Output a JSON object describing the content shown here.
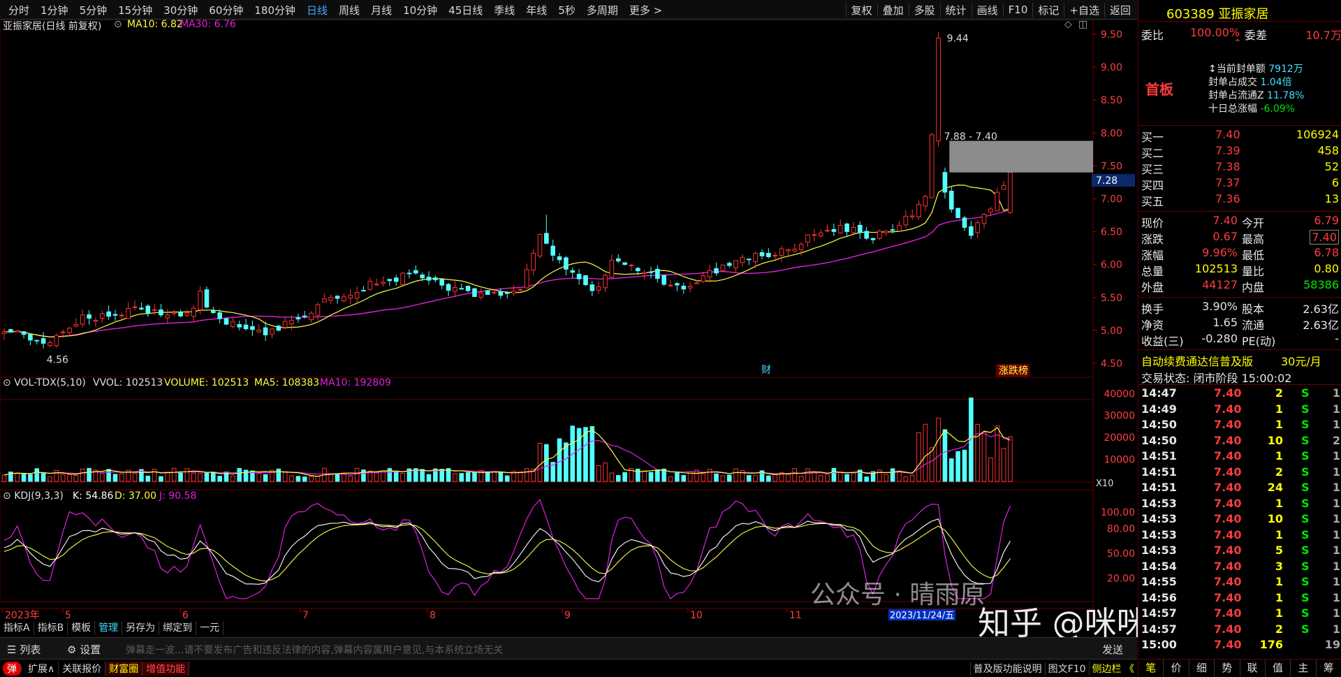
{
  "toolbar": {
    "tabs": [
      "分时",
      "1分钟",
      "5分钟",
      "15分钟",
      "30分钟",
      "60分钟",
      "180分钟",
      "日线",
      "周线",
      "月线",
      "10分钟",
      "45日线",
      "季线",
      "年线",
      "5秒",
      "多周期",
      "更多 >"
    ],
    "active": "日线",
    "tools": [
      "复权",
      "叠加",
      "多股",
      "统计",
      "画线",
      "F10",
      "标记",
      "+自选",
      "返回"
    ]
  },
  "chart": {
    "title": "亚振家居(日线 前复权)",
    "ma10": "MA10: 6.82",
    "ma30": "MA30: 6.76",
    "price_ticks": [
      "9.50",
      "9.00",
      "8.50",
      "8.00",
      "7.50",
      "7.00",
      "6.50",
      "6.00",
      "5.50",
      "5.00",
      "4.50"
    ],
    "current_price_tag": "7.28",
    "high_label": "9.44",
    "low_label": "4.56",
    "range_label": "7.88 - 7.40",
    "cai_marker": "财",
    "zhangting_marker": "涨跌榜",
    "vol_title": "VOL-TDX(5,10)",
    "vvol": "VVOL: 102513",
    "volume": "VOLUME: 102513",
    "vma5": "MA5: 108383",
    "vma10": "MA10: 192809",
    "vol_ticks": [
      "40000",
      "30000",
      "20000",
      "10000"
    ],
    "vol_unit": "X10",
    "kdj_title": "KDJ(9,3,3)",
    "kdj_k": "K: 54.86",
    "kdj_d": "D: 37.00",
    "kdj_j": "J: 90.58",
    "kdj_ticks": [
      "100.00",
      "80.00",
      "50.00",
      "20.00"
    ],
    "months": [
      "2023年",
      "5",
      "6",
      "7",
      "8",
      "9",
      "10",
      "11"
    ],
    "date_tag": "2023/11/24/五"
  },
  "colors": {
    "up": "#ff3232",
    "down": "#54ffff",
    "ma10": "#ffff44",
    "ma30": "#e020e0",
    "k": "#ffffff",
    "d": "#ffff44",
    "j": "#e020e0"
  },
  "bottom": {
    "row1": [
      "指标A",
      "指标B",
      "模板",
      "管理",
      "另存为",
      "绑定到",
      "一元"
    ],
    "row1_active": "管理",
    "list": "列表",
    "settings": "设置",
    "barrage": "弹幕走一波...请不要发布广告和违反法律的内容,弹幕内容属用户意见,与本系统立场无关",
    "send": "发送",
    "row3": [
      "弹",
      "扩展∧",
      "关联报价",
      "财富圈",
      "增值功能"
    ],
    "status_right": [
      "普及版功能说明",
      "图文F10",
      "侧边栏 《"
    ]
  },
  "panel": {
    "code": "603389",
    "name": "亚振家居",
    "weibi_label": "委比",
    "weibi": "100.00%",
    "weicha_label": "委差",
    "weicha": "10.7万",
    "first_board": "首板",
    "seal_info": [
      {
        "k": "当前封单额",
        "v": "7912万"
      },
      {
        "k": "封单占成交",
        "v": "1.04倍"
      },
      {
        "k": "封单占流通Z",
        "v": "11.78%"
      },
      {
        "k": "十日总涨幅",
        "v": "-6.09%"
      }
    ],
    "bids": [
      {
        "n": "买一",
        "p": "7.40",
        "v": "106924"
      },
      {
        "n": "买二",
        "p": "7.39",
        "v": "458"
      },
      {
        "n": "买三",
        "p": "7.38",
        "v": "52"
      },
      {
        "n": "买四",
        "p": "7.37",
        "v": "6"
      },
      {
        "n": "买五",
        "p": "7.36",
        "v": "13"
      }
    ],
    "quote": [
      [
        "现价",
        "7.40",
        "今开",
        "6.79"
      ],
      [
        "涨跌",
        "0.67",
        "最高",
        "7.40"
      ],
      [
        "涨幅",
        "9.96%",
        "最低",
        "6.78"
      ],
      [
        "总量",
        "102513",
        "量比",
        "0.80"
      ],
      [
        "外盘",
        "44127",
        "内盘",
        "58386"
      ]
    ],
    "stats": [
      [
        "换手",
        "3.90%",
        "股本",
        "2.63亿"
      ],
      [
        "净资",
        "1.65",
        "流通",
        "2.63亿"
      ],
      [
        "收益(三)",
        "-0.280",
        "PE(动)",
        "-"
      ]
    ],
    "ad": "自动续费通达信普及版",
    "ad_price": "30元/月",
    "trade_state": "交易状态: 闭市阶段 15:00:02",
    "ticks": [
      [
        "14:47",
        "7.40",
        "2",
        "S"
      ],
      [
        "14:49",
        "7.40",
        "1",
        "S"
      ],
      [
        "14:50",
        "7.40",
        "1",
        "S"
      ],
      [
        "14:50",
        "7.40",
        "10",
        "S"
      ],
      [
        "14:51",
        "7.40",
        "1",
        "S"
      ],
      [
        "14:51",
        "7.40",
        "2",
        "S"
      ],
      [
        "14:51",
        "7.40",
        "24",
        "S"
      ],
      [
        "14:53",
        "7.40",
        "1",
        "S"
      ],
      [
        "14:53",
        "7.40",
        "10",
        "S"
      ],
      [
        "14:53",
        "7.40",
        "1",
        "S"
      ],
      [
        "14:53",
        "7.40",
        "5",
        "S"
      ],
      [
        "14:54",
        "7.40",
        "3",
        "S"
      ],
      [
        "14:55",
        "7.40",
        "1",
        "S"
      ],
      [
        "14:56",
        "7.40",
        "1",
        "S"
      ],
      [
        "14:57",
        "7.40",
        "1",
        "S"
      ],
      [
        "14:57",
        "7.40",
        "2",
        "S"
      ],
      [
        "15:00",
        "7.40",
        "176",
        ""
      ]
    ],
    "tick_extra": [
      "1",
      "1",
      "1",
      "2",
      "1",
      "1",
      "1",
      "1",
      "1",
      "1",
      "1",
      "1",
      "1",
      "1",
      "1",
      "1",
      "19"
    ],
    "bottom_tabs": [
      "笔",
      "价",
      "细",
      "势",
      "联",
      "值",
      "主",
      "筹"
    ]
  },
  "watermark": {
    "a": "公众号 · 晴雨原",
    "b": "知乎 @咪咪小超人"
  }
}
